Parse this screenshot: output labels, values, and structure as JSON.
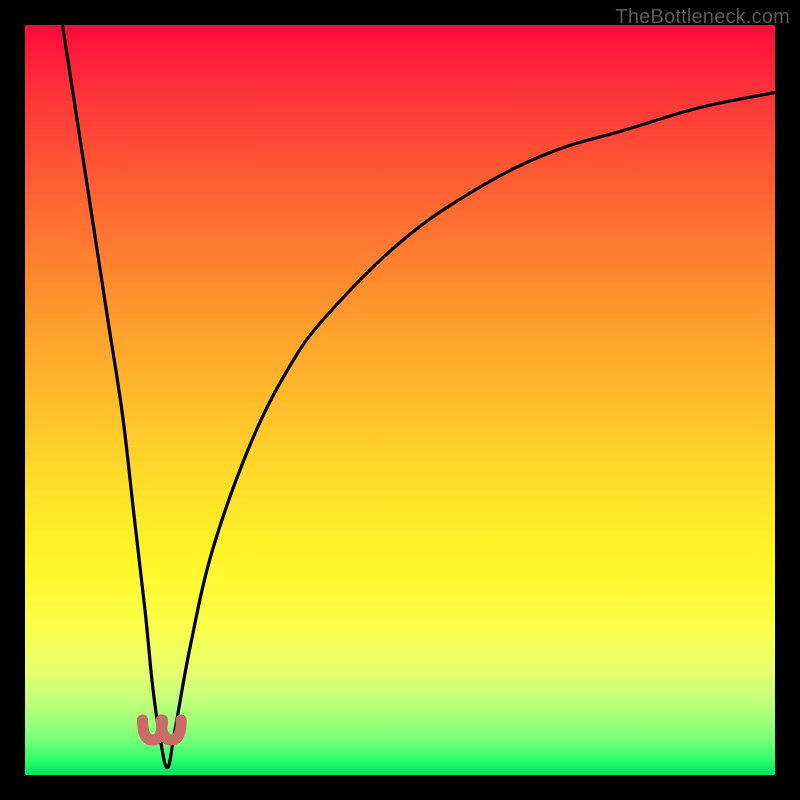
{
  "watermark": "TheBottleneck.com",
  "colors": {
    "frame": "#000000",
    "gradient_top": "#ff0a3a",
    "gradient_mid": "#ffe129",
    "gradient_bottom": "#00e060",
    "curve": "#000000",
    "marker": "#c96b66"
  },
  "chart_data": {
    "type": "line",
    "title": "",
    "xlabel": "",
    "ylabel": "",
    "xlim": [
      0,
      100
    ],
    "ylim": [
      0,
      100
    ],
    "series": [
      {
        "name": "bottleneck-curve",
        "x": [
          5,
          7,
          9,
          11,
          13,
          14.5,
          16,
          17,
          18,
          19,
          20,
          22,
          25,
          30,
          35,
          40,
          50,
          60,
          70,
          80,
          90,
          100
        ],
        "values": [
          100,
          87,
          74,
          61,
          48,
          35,
          22,
          12,
          5,
          1,
          6,
          17,
          30,
          44,
          54,
          61,
          71,
          78,
          83,
          86,
          89,
          91
        ]
      }
    ],
    "markers": [
      {
        "name": "valley-lobe-left",
        "x": 17.0,
        "y": 6
      },
      {
        "name": "valley-lobe-right",
        "x": 19.5,
        "y": 6
      }
    ],
    "notes": "Values are estimated from pixel positions; no numeric axis ticks are printed in the source image."
  }
}
